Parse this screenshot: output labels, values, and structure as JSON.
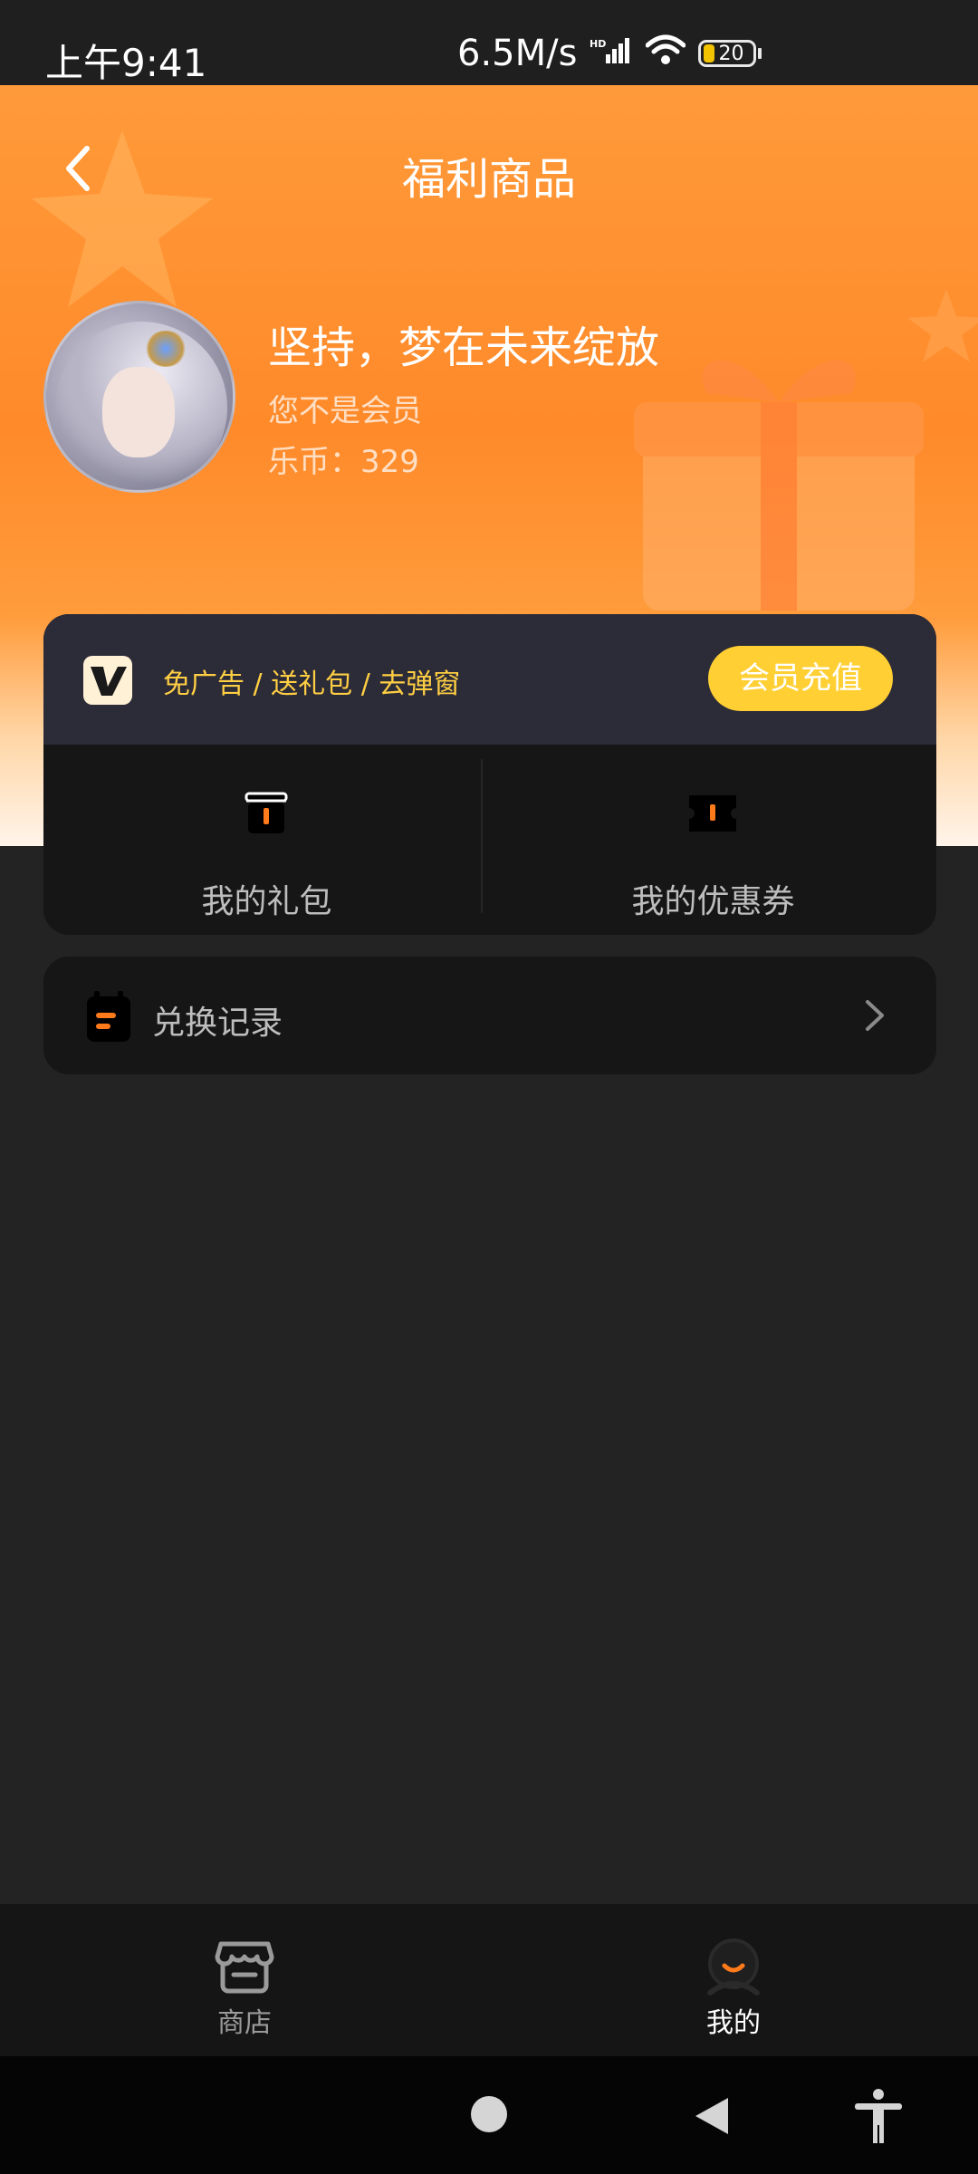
{
  "status_bar": {
    "time": "上午9:41",
    "network_speed": "6.5M/s",
    "battery_level": "20"
  },
  "header": {
    "title": "福利商品"
  },
  "profile": {
    "name": "坚持，梦在未来绽放",
    "member_status": "您不是会员",
    "coins": "乐币：329"
  },
  "vip_banner": {
    "benefits": "免广告 / 送礼包 / 去弹窗",
    "recharge_label": "会员充值"
  },
  "quick_links": [
    {
      "label": "我的礼包",
      "icon": "gift-icon"
    },
    {
      "label": "我的优惠券",
      "icon": "coupon-icon"
    }
  ],
  "exchange_record": {
    "label": "兑换记录"
  },
  "bottom_nav": {
    "items": [
      {
        "label": "商店",
        "icon": "store-icon",
        "active": false
      },
      {
        "label": "我的",
        "icon": "profile-icon",
        "active": true
      }
    ]
  },
  "colors": {
    "accent_orange": "#ff8a2a",
    "vip_yellow": "#ffcf34",
    "background": "#232323"
  }
}
